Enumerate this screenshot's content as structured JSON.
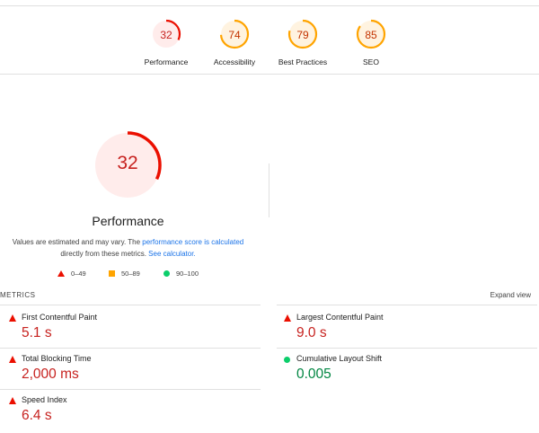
{
  "gauges": [
    {
      "score": "32",
      "label": "Performance",
      "color": "#eb0f00",
      "fill": "#ffeceb",
      "text_color": "#c7221f",
      "fraction": 0.32
    },
    {
      "score": "74",
      "label": "Accessibility",
      "color": "#ffa400",
      "fill": "#fff3e0",
      "text_color": "#c33300",
      "fraction": 0.74
    },
    {
      "score": "79",
      "label": "Best Practices",
      "color": "#ffa400",
      "fill": "#fff3e0",
      "text_color": "#c33300",
      "fraction": 0.79
    },
    {
      "score": "85",
      "label": "SEO",
      "color": "#ffa400",
      "fill": "#fff3e0",
      "text_color": "#c33300",
      "fraction": 0.85
    }
  ],
  "performance": {
    "score": "32",
    "fraction": 0.32,
    "title": "Performance",
    "desc_prefix": "Values are estimated and may vary. The ",
    "desc_link1": "performance score is calculated",
    "desc_mid": " directly from these metrics. ",
    "desc_link2": "See calculator.",
    "legend": {
      "fail": "0–49",
      "average": "50–89",
      "pass": "90–100"
    }
  },
  "metrics": {
    "heading": "METRICS",
    "expand_label": "Expand view",
    "items": [
      {
        "label": "First Contentful Paint",
        "value": "5.1 s",
        "status": "fail"
      },
      {
        "label": "Largest Contentful Paint",
        "value": "9.0 s",
        "status": "fail"
      },
      {
        "label": "Total Blocking Time",
        "value": "2,000 ms",
        "status": "fail"
      },
      {
        "label": "Cumulative Layout Shift",
        "value": "0.005",
        "status": "pass"
      },
      {
        "label": "Speed Index",
        "value": "6.4 s",
        "status": "fail"
      }
    ]
  },
  "colors": {
    "fail": "#eb0f00",
    "average": "#ffa400",
    "pass": "#0cce6b",
    "link": "#1a73e8"
  }
}
